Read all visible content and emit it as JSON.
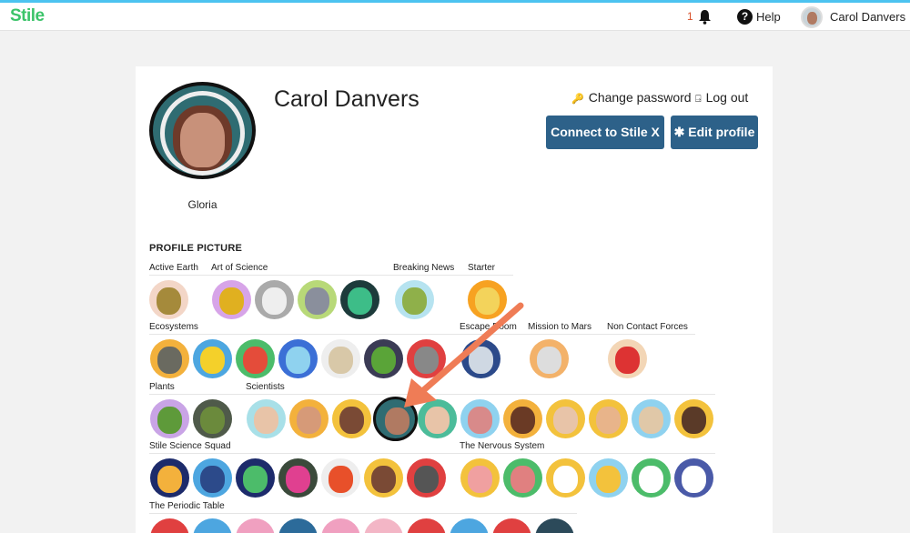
{
  "nav": {
    "logo": "Stile",
    "notification_count": "1",
    "help_label": "Help",
    "user_name": "Carol Danvers"
  },
  "profile": {
    "name": "Carol Danvers",
    "avatar_name": "Gloria",
    "change_password_label": "Change password",
    "logout_label": "Log out",
    "connect_label": "Connect to Stile X",
    "edit_profile_label": "Edit profile",
    "section_title": "PROFILE PICTURE"
  },
  "groups": {
    "active_earth": "Active Earth",
    "art_of_science": "Art of Science",
    "breaking_news": "Breaking News",
    "starter": "Starter",
    "ecosystems": "Ecosystems",
    "escape_room": "Escape Room",
    "mission_to_mars": "Mission to Mars",
    "non_contact_forces": "Non Contact Forces",
    "plants": "Plants",
    "scientists": "Scientists",
    "stile_science_squad": "Stile Science Squad",
    "the_nervous_system": "The Nervous System",
    "the_periodic_table": "The Periodic Table"
  },
  "colors": {
    "brand_green": "#3cc46a",
    "button_blue": "#2d6189",
    "arrow_orange": "#ef7c56"
  }
}
